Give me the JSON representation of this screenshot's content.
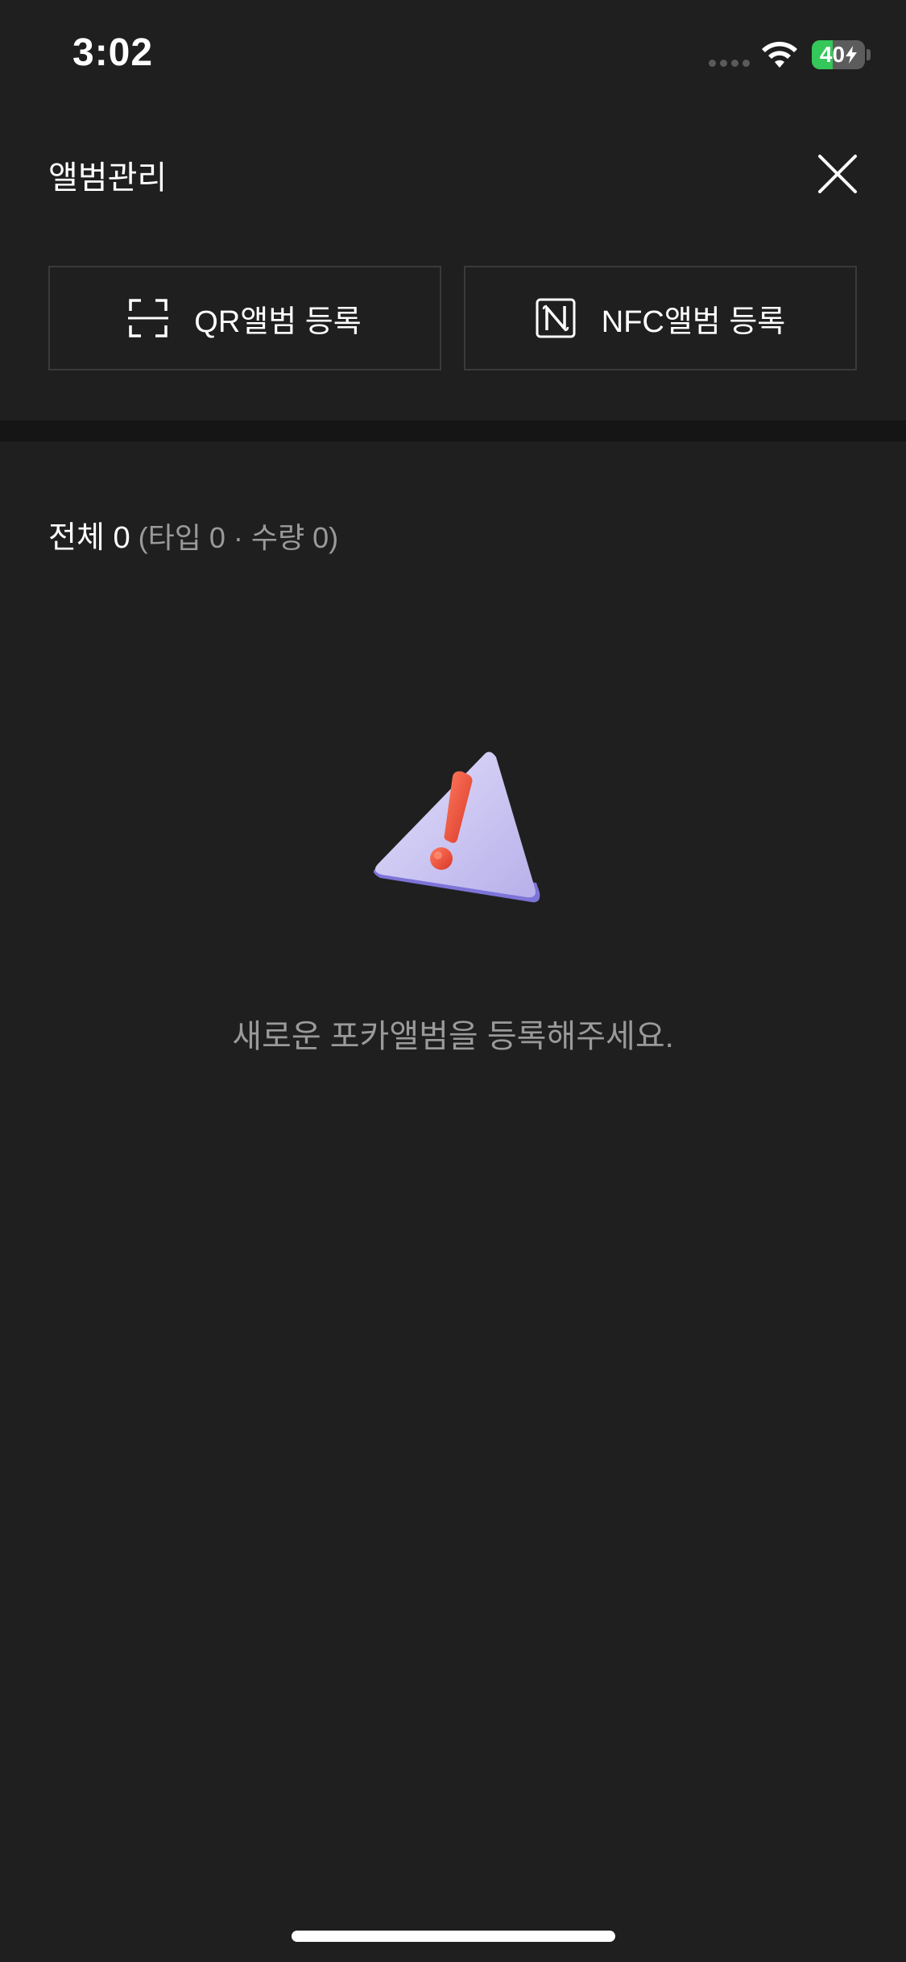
{
  "status_bar": {
    "time": "3:02",
    "battery_text": "40",
    "battery_level": 0.4,
    "battery_color": "#34c759",
    "icons": [
      "signal-dots-icon",
      "wifi-icon",
      "battery-icon",
      "bolt-icon"
    ]
  },
  "header": {
    "title": "앨범관리",
    "close_icon": "close-icon"
  },
  "actions": {
    "qr_label": "QR앨범 등록",
    "qr_icon": "qr-scan-icon",
    "nfc_label": "NFC앨범 등록",
    "nfc_icon": "nfc-icon"
  },
  "summary": {
    "total": "전체 0",
    "detail": "(타입 0 · 수량 0)"
  },
  "empty_state": {
    "icon": "warning-icon",
    "message": "새로운 포카앨범을 등록해주세요."
  },
  "colors": {
    "background": "#1f1f1f",
    "divider": "#151515",
    "border": "#3a3a3a",
    "muted_text": "#9a9a9a",
    "warning_body": "#cbc6f2",
    "warning_mark": "#e8503c"
  }
}
